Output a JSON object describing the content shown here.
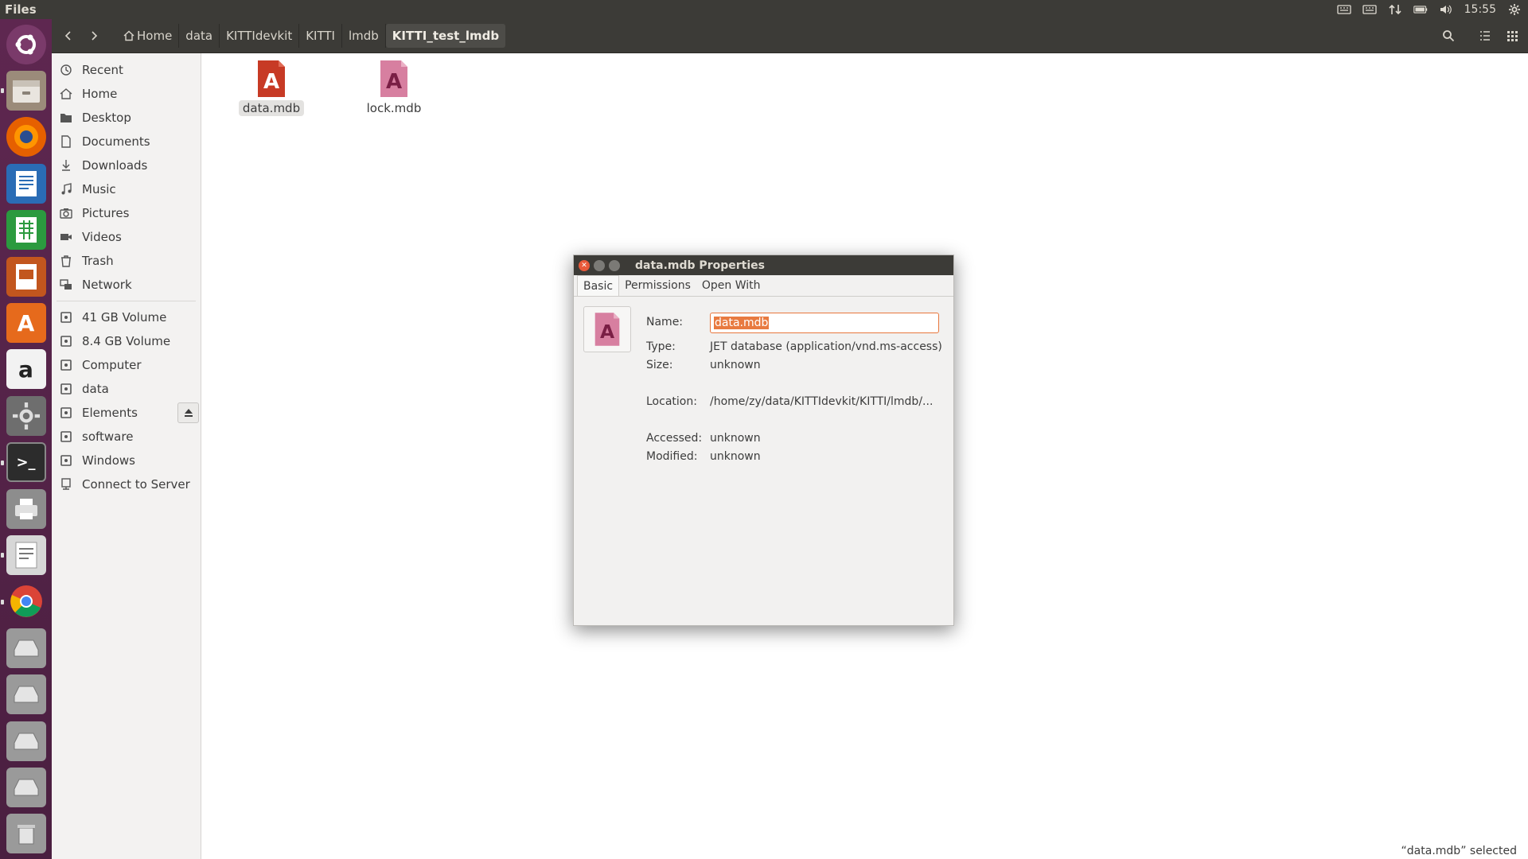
{
  "top_panel": {
    "app_title": "Files",
    "clock": "15:55",
    "indicators": [
      "keyboard-icon",
      "keyboard-icon",
      "network-updown-icon",
      "battery-icon",
      "volume-icon",
      "gear-icon"
    ]
  },
  "launcher": {
    "items": [
      "ubuntu-dash-icon",
      "files-icon",
      "firefox-icon",
      "writer-icon",
      "calc-icon",
      "impress-icon",
      "software-center-icon",
      "amazon-icon",
      "system-settings-icon",
      "terminal-icon",
      "printer-icon",
      "text-editor-icon",
      "chrome-icon",
      "drive-icon",
      "drive-icon",
      "drive-icon",
      "drive-icon",
      "drive-icon",
      "trash-icon"
    ]
  },
  "toolbar": {
    "breadcrumbs": [
      "Home",
      "data",
      "KITTIdevkit",
      "KITTI",
      "lmdb",
      "KITTI_test_lmdb"
    ]
  },
  "sidebar": {
    "places": [
      {
        "label": "Recent",
        "icon": "clock-icon"
      },
      {
        "label": "Home",
        "icon": "home-icon"
      },
      {
        "label": "Desktop",
        "icon": "folder-icon"
      },
      {
        "label": "Documents",
        "icon": "document-icon"
      },
      {
        "label": "Downloads",
        "icon": "download-icon"
      },
      {
        "label": "Music",
        "icon": "music-icon"
      },
      {
        "label": "Pictures",
        "icon": "camera-icon"
      },
      {
        "label": "Videos",
        "icon": "video-icon"
      },
      {
        "label": "Trash",
        "icon": "trash-icon"
      },
      {
        "label": "Network",
        "icon": "network-icon"
      }
    ],
    "devices": [
      {
        "label": "41 GB Volume",
        "icon": "drive-icon"
      },
      {
        "label": "8.4 GB Volume",
        "icon": "drive-icon"
      },
      {
        "label": "Computer",
        "icon": "drive-icon"
      },
      {
        "label": "data",
        "icon": "drive-icon"
      },
      {
        "label": "Elements",
        "icon": "drive-icon"
      },
      {
        "label": "software",
        "icon": "drive-icon"
      },
      {
        "label": "Windows",
        "icon": "drive-icon"
      },
      {
        "label": "Connect to Server",
        "icon": "server-icon"
      }
    ]
  },
  "files": [
    {
      "name": "data.mdb",
      "selected": true
    },
    {
      "name": "lock.mdb",
      "selected": false
    }
  ],
  "status": "“data.mdb” selected",
  "dialog": {
    "title": "data.mdb Properties",
    "tabs": [
      "Basic",
      "Permissions",
      "Open With"
    ],
    "name_label": "Name:",
    "name_value": "data.mdb",
    "type_label": "Type:",
    "type_value": "JET database (application/vnd.ms-access)",
    "size_label": "Size:",
    "size_value": "unknown",
    "location_label": "Location:",
    "location_value": "/home/zy/data/KITTIdevkit/KITTI/lmdb/...",
    "accessed_label": "Accessed:",
    "accessed_value": "unknown",
    "modified_label": "Modified:",
    "modified_value": "unknown"
  },
  "colors": {
    "accent": "#e8763c",
    "panel": "#3c3b37",
    "launcher": "#5e2750"
  }
}
